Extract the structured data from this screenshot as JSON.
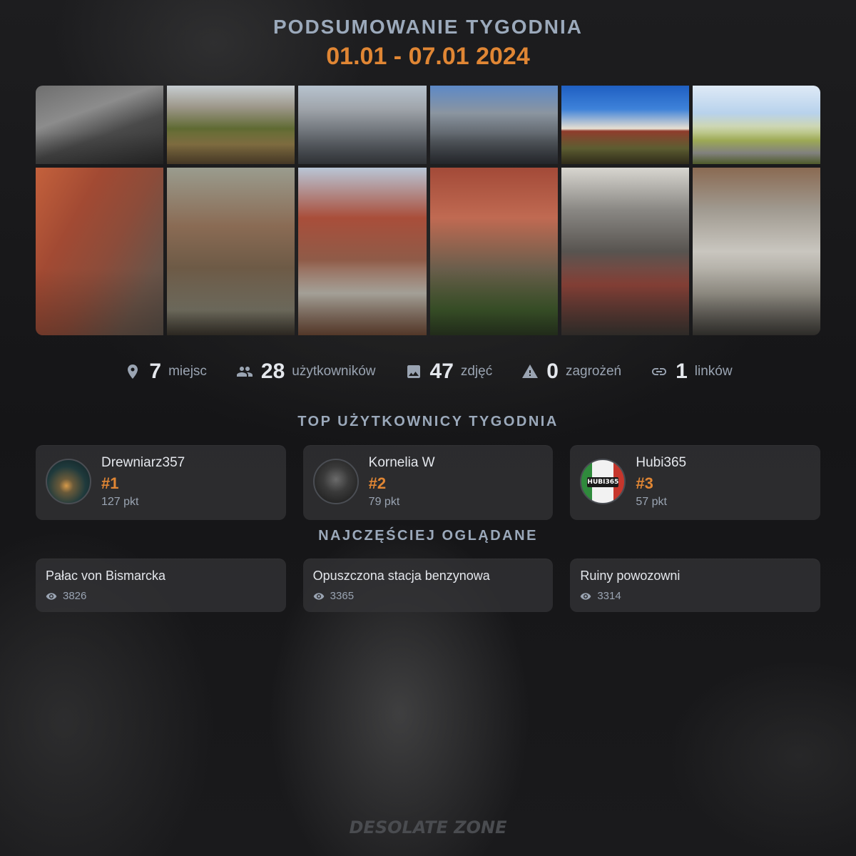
{
  "header": {
    "title": "PODSUMOWANIE TYGODNIA",
    "date_range": "01.01 - 07.01 2024"
  },
  "photos": [
    {
      "name": "photo-ruin-staircase"
    },
    {
      "name": "photo-overgrown-field"
    },
    {
      "name": "photo-manor-facade-1"
    },
    {
      "name": "photo-manor-facade-2"
    },
    {
      "name": "photo-manor-blue-sky"
    },
    {
      "name": "photo-gas-station-road"
    },
    {
      "name": "photo-brick-wall-trees"
    },
    {
      "name": "photo-brick-corridor"
    },
    {
      "name": "photo-brick-window-ruin"
    },
    {
      "name": "photo-brick-doorway-tree"
    },
    {
      "name": "photo-boiler-room"
    },
    {
      "name": "photo-basement-window"
    }
  ],
  "stats": [
    {
      "icon": "location-pin-icon",
      "value": "7",
      "label": "miejsc"
    },
    {
      "icon": "users-icon",
      "value": "28",
      "label": "użytkowników"
    },
    {
      "icon": "image-icon",
      "value": "47",
      "label": "zdjęć"
    },
    {
      "icon": "warning-icon",
      "value": "0",
      "label": "zagrożeń"
    },
    {
      "icon": "link-icon",
      "value": "1",
      "label": "linków"
    }
  ],
  "top_users": {
    "title": "TOP UŻYTKOWNICY TYGODNIA",
    "users": [
      {
        "name": "Drewniarz357",
        "rank": "#1",
        "points": "127 pkt"
      },
      {
        "name": "Kornelia W",
        "rank": "#2",
        "points": "79 pkt"
      },
      {
        "name": "Hubi365",
        "rank": "#3",
        "points": "57 pkt",
        "avatar_text": "HUBI365"
      }
    ]
  },
  "most_viewed": {
    "title": "NAJCZĘŚCIEJ OGLĄDANE",
    "places": [
      {
        "name": "Pałac von Bismarcka",
        "views": "3826"
      },
      {
        "name": "Opuszczona stacja benzynowa",
        "views": "3365"
      },
      {
        "name": "Ruiny powozowni",
        "views": "3314"
      }
    ]
  },
  "brand": "DESOLATE ZONE",
  "colors": {
    "accent": "#e08634",
    "title": "#9ba9bb",
    "muted": "#9aa4b2",
    "card": "#343438"
  }
}
